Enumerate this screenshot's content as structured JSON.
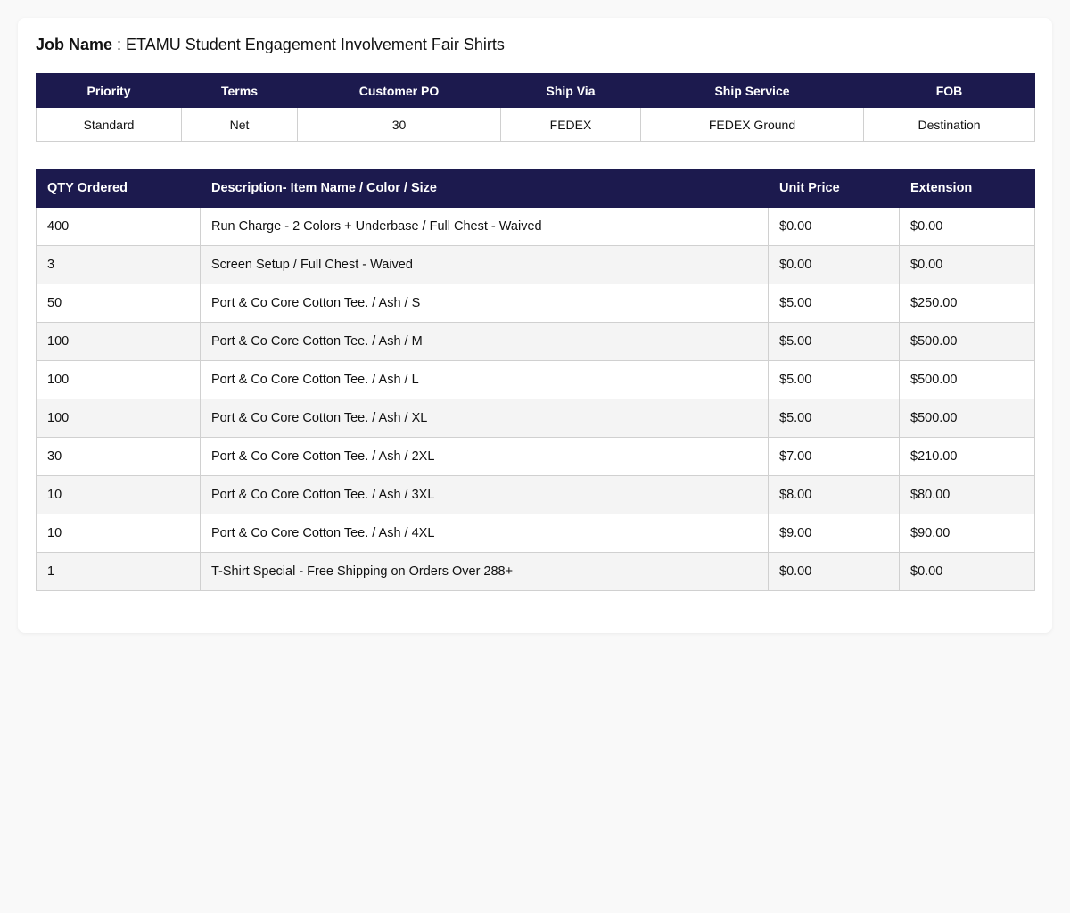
{
  "job": {
    "label": "Job Name",
    "separator": " : ",
    "value": "ETAMU Student Engagement Involvement Fair Shirts"
  },
  "info": {
    "headers": [
      "Priority",
      "Terms",
      "Customer PO",
      "Ship Via",
      "Ship Service",
      "FOB"
    ],
    "values": [
      "Standard",
      "Net",
      "30",
      "FEDEX",
      "FEDEX Ground",
      "Destination"
    ]
  },
  "items": {
    "headers": [
      "QTY Ordered",
      "Description- Item Name / Color / Size",
      "Unit Price",
      "Extension"
    ],
    "rows": [
      [
        "400",
        "Run Charge - 2 Colors + Underbase / Full Chest - Waived",
        "$0.00",
        "$0.00"
      ],
      [
        "3",
        "Screen Setup / Full Chest - Waived",
        "$0.00",
        "$0.00"
      ],
      [
        "50",
        "Port & Co Core Cotton Tee. / Ash / S",
        "$5.00",
        "$250.00"
      ],
      [
        "100",
        "Port & Co Core Cotton Tee. / Ash / M",
        "$5.00",
        "$500.00"
      ],
      [
        "100",
        "Port & Co Core Cotton Tee. / Ash / L",
        "$5.00",
        "$500.00"
      ],
      [
        "100",
        "Port & Co Core Cotton Tee. / Ash / XL",
        "$5.00",
        "$500.00"
      ],
      [
        "30",
        "Port & Co Core Cotton Tee. / Ash / 2XL",
        "$7.00",
        "$210.00"
      ],
      [
        "10",
        "Port & Co Core Cotton Tee. / Ash / 3XL",
        "$8.00",
        "$80.00"
      ],
      [
        "10",
        "Port & Co Core Cotton Tee. / Ash / 4XL",
        "$9.00",
        "$90.00"
      ],
      [
        "1",
        "T-Shirt Special - Free Shipping on Orders Over 288+",
        "$0.00",
        "$0.00"
      ]
    ]
  },
  "colors": {
    "header_bg": "#1c1a4e",
    "header_text": "#ffffff",
    "alt_row_bg": "#f4f4f4"
  }
}
